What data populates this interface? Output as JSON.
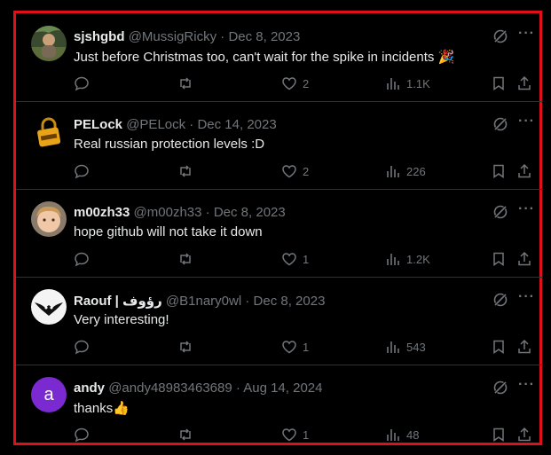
{
  "posts": [
    {
      "name": "sjshgbd",
      "handle": "@MussigRicky",
      "sep": "·",
      "date": "Dec 8, 2023",
      "text": "Just before Christmas too, can't wait for the spike in incidents 🎉",
      "likes": "2",
      "views": "1.1K",
      "avatar": "photo-avatar"
    },
    {
      "name": "PELock",
      "handle": "@PELock",
      "sep": "·",
      "date": "Dec 14, 2023",
      "text": "Real russian protection levels :D",
      "likes": "2",
      "views": "226",
      "avatar": "padlock-avatar"
    },
    {
      "name": "m00zh33",
      "handle": "@m00zh33",
      "sep": "·",
      "date": "Dec 8, 2023",
      "text": "hope github will not take it down",
      "likes": "1",
      "views": "1.2K",
      "avatar": "child-photo-avatar"
    },
    {
      "name": "Raouf | رؤوف",
      "handle": "@B1nary0wl",
      "sep": "·",
      "date": "Dec 8, 2023",
      "text": "Very interesting!",
      "likes": "1",
      "views": "543",
      "avatar": "owl-logo-avatar"
    },
    {
      "name": "andy",
      "handle": "@andy48983463689",
      "sep": "·",
      "date": "Aug 14, 2024",
      "text": "thanks👍",
      "likes": "1",
      "views": "48",
      "avatar_letter": "a",
      "avatar_color": "#7b2ad1"
    }
  ],
  "colors": {
    "background": "#000000",
    "highlight_border": "#e0101a",
    "text": "#e7e9ea",
    "muted": "#71767b",
    "divider": "#2f3336"
  },
  "icons": {
    "more": "more-dots-icon",
    "grok": "grok-icon",
    "reply": "reply-icon",
    "repost": "repost-icon",
    "like": "heart-icon",
    "views": "views-bar-chart-icon",
    "bookmark": "bookmark-icon",
    "share": "share-icon"
  }
}
